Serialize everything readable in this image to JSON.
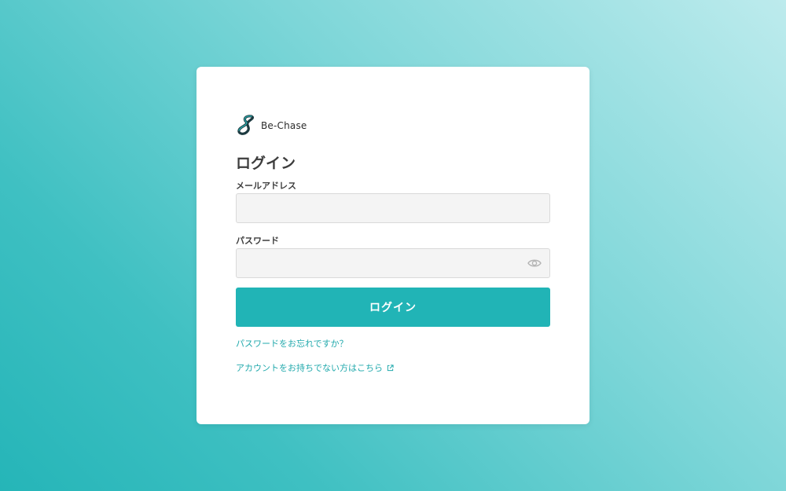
{
  "brand": {
    "name": "Be-Chase",
    "logo_color": "#1e7f86",
    "logo_dark": "#1d3a40"
  },
  "login": {
    "title": "ログイン",
    "email_label": "メールアドレス",
    "email_value": "",
    "password_label": "パスワード",
    "password_value": "",
    "submit_label": "ログイン",
    "forgot_link": "パスワードをお忘れですか？",
    "signup_link": "アカウントをお持ちでない方はこちら"
  },
  "icons": {
    "password_toggle": "eye-icon",
    "signup_external": "external-link-icon"
  },
  "colors": {
    "accent": "#21b4b6",
    "link": "#21a9ac",
    "input_bg": "#f4f4f4",
    "card_bg": "#ffffff"
  }
}
